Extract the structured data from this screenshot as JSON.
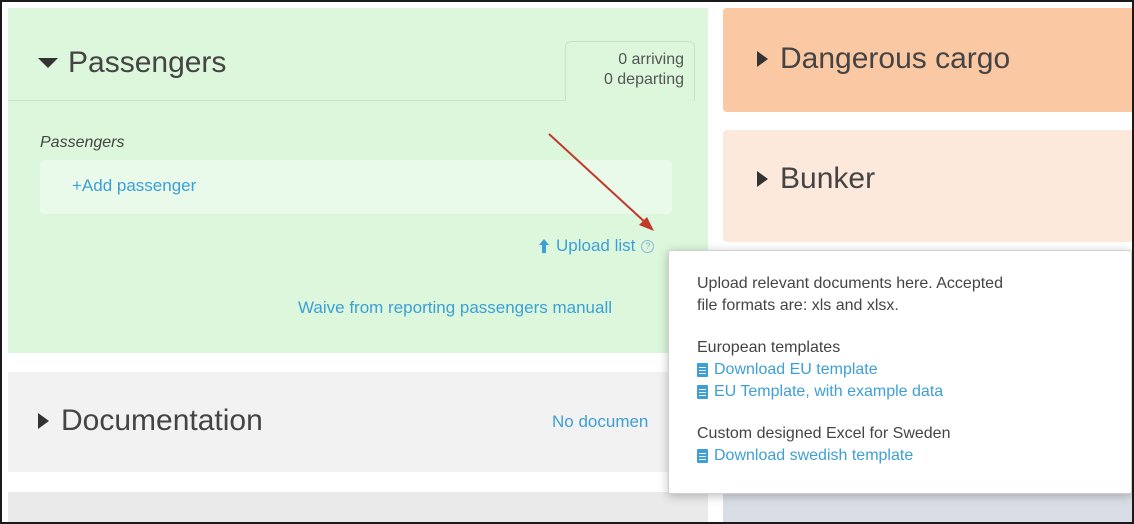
{
  "passengers": {
    "title": "Passengers",
    "arriving": "0 arriving",
    "departing": "0 departing",
    "section_label": "Passengers",
    "add_label": "+Add passenger",
    "upload_label": "Upload list",
    "help_glyph": "?",
    "waive_label": "Waive from reporting passengers manuall"
  },
  "documentation": {
    "title": "Documentation",
    "status": "No documen"
  },
  "dangerous_cargo": {
    "title": "Dangerous cargo"
  },
  "bunker": {
    "title": "Bunker"
  },
  "tooltip": {
    "line1": "Upload relevant documents here. Accepted",
    "line2": "file formats are: xls and xlsx.",
    "eu_heading": "European templates",
    "eu_download": "Download EU template",
    "eu_example": "EU Template, with example data",
    "se_heading": "Custom designed Excel for Sweden",
    "se_download": "Download swedish template"
  },
  "colors": {
    "link": "#3d9fd6",
    "passengers_bg": "#dcf7dc",
    "dangerous_bg": "#fbc8a4",
    "bunker_bg": "#fde9dc",
    "annotation_arrow": "#c0392b"
  }
}
